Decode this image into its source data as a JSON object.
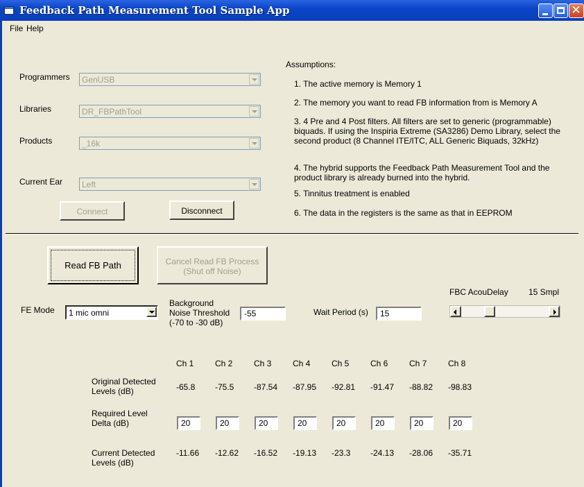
{
  "window": {
    "title": "Feedback Path Measurement Tool Sample App"
  },
  "menu": {
    "file": "File",
    "help": "Help"
  },
  "connection": {
    "programmers_label": "Programmers",
    "programmers_value": "GenUSB",
    "libraries_label": "Libraries",
    "libraries_value": "DR_FBPathTool",
    "products_label": "Products",
    "products_value": "_16k",
    "ear_label": "Current Ear",
    "ear_value": "Left",
    "connect_label": "Connect",
    "disconnect_label": "Disconnect"
  },
  "assumptions": {
    "heading": "Assumptions:",
    "items": [
      "1. The active memory is Memory 1",
      "2. The memory you want to read FB information from is Memory A",
      "3. 4 Pre and 4 Post filters. All filters are set to generic (programmable) biquads. If using the Inspiria Extreme (SA3286) Demo Library, select the second product (8 Channel ITE/ITC, ALL Generic Biquads, 32kHz)",
      "4. The hybrid supports the Feedback Path Measurement Tool and the product library is already burned into the hybrid.",
      "5. Tinnitus treatment is enabled",
      "6. The data in the registers is the same as that in EEPROM"
    ]
  },
  "controls": {
    "read_label": "Read FB Path",
    "cancel_line1": "Cancel Read FB Process",
    "cancel_line2": "(Shut off Noise)",
    "fe_mode_label": "FE Mode",
    "fe_mode_value": "1 mic omni",
    "bg_label_1": "Background",
    "bg_label_2": "Noise Threshold",
    "bg_label_3": "(-70 to -30 dB)",
    "bg_value": "-55",
    "wait_label": "Wait Period (s)",
    "wait_value": "15",
    "fbc_label": "FBC AcouDelay",
    "fbc_value": "15 Smpl",
    "fbc_slider_position": 0.3
  },
  "table": {
    "channels": [
      "Ch 1",
      "Ch 2",
      "Ch 3",
      "Ch 4",
      "Ch 5",
      "Ch 6",
      "Ch 7",
      "Ch 8"
    ],
    "original_label_1": "Original Detected",
    "original_label_2": "Levels (dB)",
    "original": [
      "-65.8",
      "-75.5",
      "-87.54",
      "-87.95",
      "-92.81",
      "-91.47",
      "-88.82",
      "-98.83"
    ],
    "required_label_1": "Required Level",
    "required_label_2": "Delta (dB)",
    "required": [
      "20",
      "20",
      "20",
      "20",
      "20",
      "20",
      "20",
      "20"
    ],
    "current_label_1": "Current Detected",
    "current_label_2": "Levels (dB)",
    "current": [
      "-11.66",
      "-12.62",
      "-16.52",
      "-19.13",
      "-23.3",
      "-24.13",
      "-28.06",
      "-35.71"
    ]
  },
  "colors": {
    "titlebar": "#0b45c9",
    "face": "#ece9d8",
    "disabled_text": "#a19e91"
  }
}
